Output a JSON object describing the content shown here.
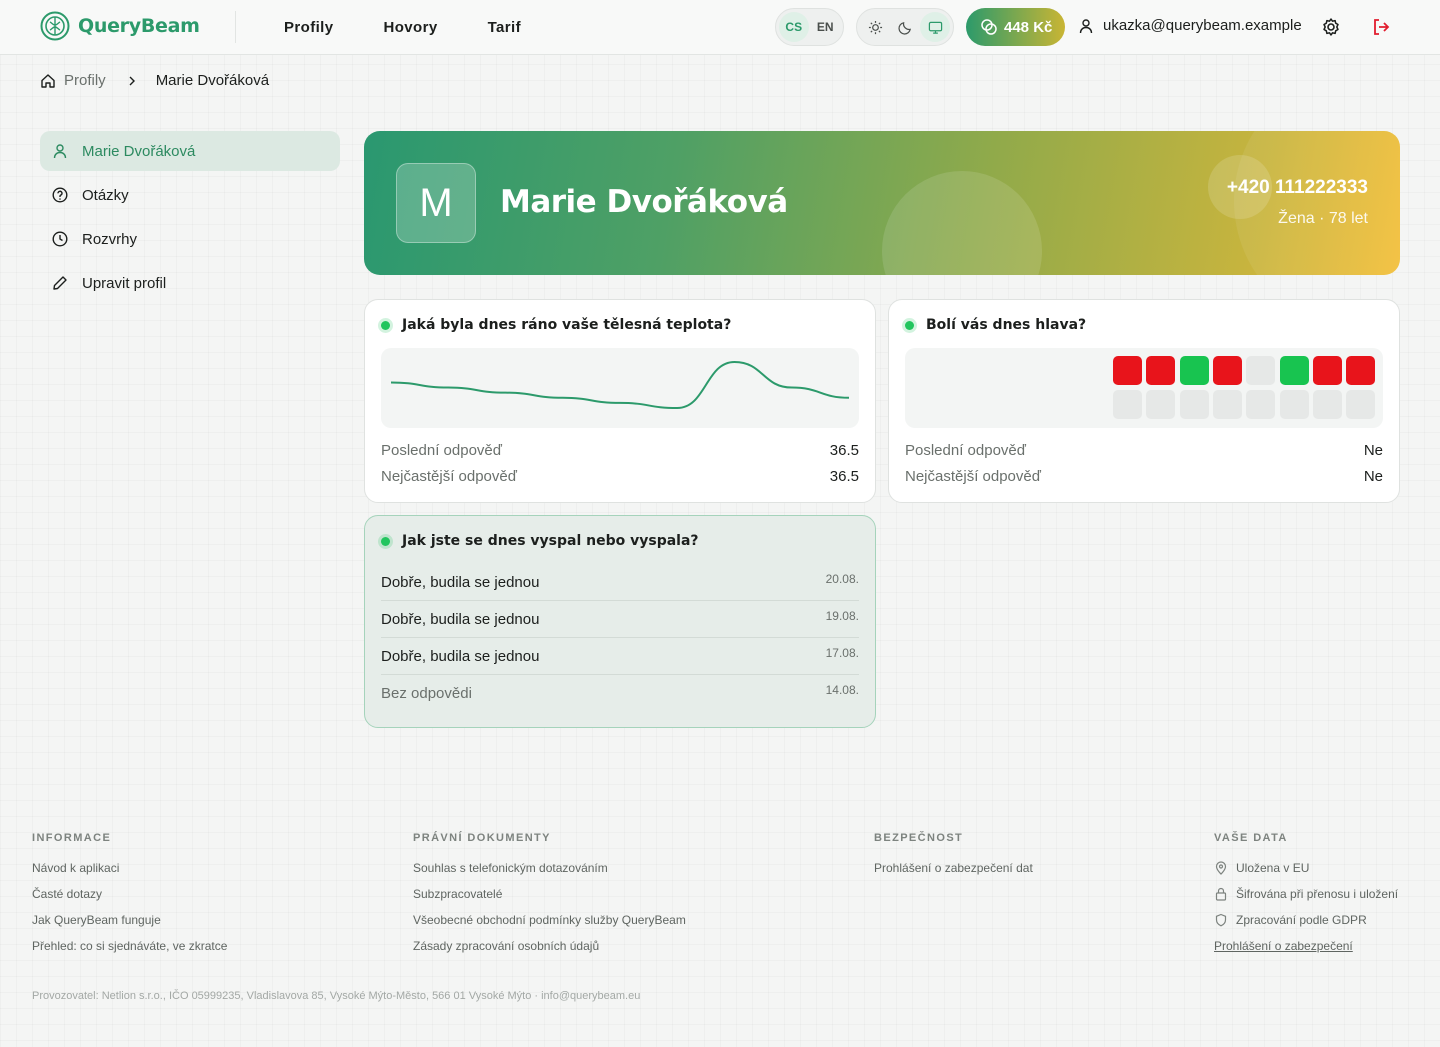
{
  "brand": {
    "name": "QueryBeam",
    "accent": "#2c9a6b"
  },
  "nav": {
    "profiles": "Profily",
    "calls": "Hovory",
    "tariff": "Tarif"
  },
  "lang": {
    "cs": "CS",
    "en": "EN",
    "selected": "CS"
  },
  "theme": {
    "selected": "system",
    "icons": [
      "sun-icon",
      "moon-icon",
      "monitor-icon"
    ]
  },
  "credit": {
    "amount": "448 Kč"
  },
  "user": {
    "email": "ukazka@querybeam.example"
  },
  "breadcrumb": {
    "root": "Profily",
    "current": "Marie Dvořáková"
  },
  "sidebar": {
    "items": [
      {
        "label": "Marie Dvořáková",
        "icon": "user-icon",
        "active": true
      },
      {
        "label": "Otázky",
        "icon": "question-icon",
        "active": false
      },
      {
        "label": "Rozvrhy",
        "icon": "clock-icon",
        "active": false
      },
      {
        "label": "Upravit profil",
        "icon": "pencil-icon",
        "active": false
      }
    ]
  },
  "profile": {
    "initial": "M",
    "name": "Marie Dvořáková",
    "phone": "+420 111222333",
    "meta": "Žena · 78 let"
  },
  "cards": {
    "temperature": {
      "question": "Jaká byla dnes ráno vaše tělesná teplota?",
      "last_label": "Poslední odpověď",
      "last_value": "36.5",
      "common_label": "Nejčastější odpověď",
      "common_value": "36.5"
    },
    "headache": {
      "question": "Bolí vás dnes hlava?",
      "last_label": "Poslední odpověď",
      "last_value": "Ne",
      "common_label": "Nejčastější odpověď",
      "common_value": "Ne"
    },
    "sleep": {
      "question": "Jak jste se dnes vyspal nebo vyspala?",
      "rows": [
        {
          "answer": "Dobře, budila se jednou",
          "date": "20.08."
        },
        {
          "answer": "Dobře, budila se jednou",
          "date": "19.08."
        },
        {
          "answer": "Dobře, budila se jednou",
          "date": "17.08."
        },
        {
          "answer": "Bez odpovědi",
          "date": "14.08."
        }
      ]
    }
  },
  "chart_data": [
    {
      "type": "line",
      "series": [
        {
          "values": [
            36.7,
            36.6,
            36.5,
            36.4,
            36.3,
            36.2,
            37.1,
            36.6,
            36.4
          ]
        }
      ],
      "xlabel": "",
      "ylabel": "",
      "grid": false
    },
    {
      "type": "heatmap",
      "rows": 2,
      "cells_top": [
        "red",
        "red",
        "green",
        "red",
        "empty",
        "green",
        "red",
        "red"
      ],
      "cells_bottom": [
        "empty",
        "empty",
        "empty",
        "empty",
        "empty",
        "empty",
        "empty",
        "empty"
      ],
      "colors": {
        "red": "#e8141b",
        "green": "#18c450",
        "empty": "#e6e8e7"
      }
    }
  ],
  "footer": {
    "info": {
      "heading": "INFORMACE",
      "links": [
        "Návod k aplikaci",
        "Časté dotazy",
        "Jak QueryBeam funguje",
        "Přehled: co si sjednáváte, ve zkratce"
      ]
    },
    "legal": {
      "heading": "PRÁVNÍ DOKUMENTY",
      "links": [
        "Souhlas s telefonickým dotazováním",
        "Subzpracovatelé",
        "Všeobecné obchodní podmínky služby QueryBeam",
        "Zásady zpracování osobních údajů"
      ]
    },
    "security": {
      "heading": "BEZPEČNOST",
      "links": [
        "Prohlášení o zabezpečení dat"
      ]
    },
    "data": {
      "heading": "VAŠE DATA",
      "items": [
        "Uložena v EU",
        "Šifrována při přenosu i uložení",
        "Zpracování podle GDPR"
      ],
      "link": "Prohlášení o zabezpečení"
    },
    "provider": "Provozovatel: Netlion s.r.o., IČO 05999235, Vladislavova 85, Vysoké Mýto-Město, 566 01 Vysoké Mýto · info@querybeam.eu"
  }
}
